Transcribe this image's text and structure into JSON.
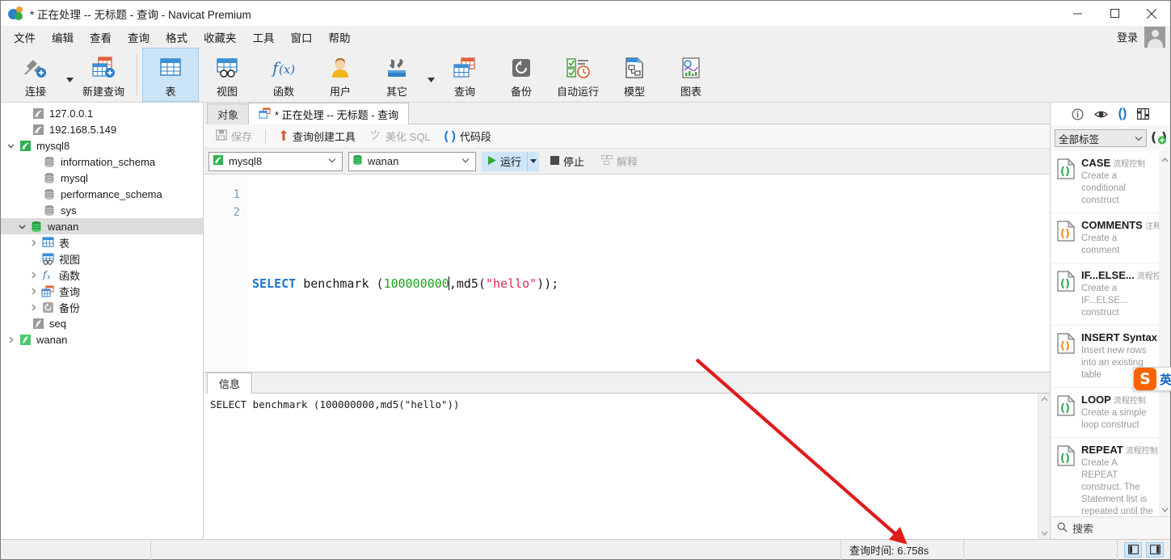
{
  "window": {
    "title": "* 正在处理 -- 无标题 - 查询 - Navicat Premium",
    "minimize_label": "最小化",
    "maximize_label": "最大化",
    "close_label": "关闭"
  },
  "menubar": {
    "items": [
      {
        "label": "文件"
      },
      {
        "label": "编辑"
      },
      {
        "label": "查看"
      },
      {
        "label": "查询"
      },
      {
        "label": "格式"
      },
      {
        "label": "收藏夹"
      },
      {
        "label": "工具"
      },
      {
        "label": "窗口"
      },
      {
        "label": "帮助"
      }
    ],
    "login_label": "登录"
  },
  "ribbon": {
    "items": [
      {
        "label": "连接",
        "icon": "connection-icon",
        "has_caret": true,
        "selected": false
      },
      {
        "label": "新建查询",
        "icon": "new-query-icon",
        "has_caret": false,
        "selected": false
      },
      {
        "label": "表",
        "icon": "table-icon",
        "has_caret": false,
        "selected": true
      },
      {
        "label": "视图",
        "icon": "view-icon",
        "has_caret": false,
        "selected": false
      },
      {
        "label": "函数",
        "icon": "function-icon",
        "has_caret": false,
        "selected": false
      },
      {
        "label": "用户",
        "icon": "user-icon",
        "has_caret": false,
        "selected": false
      },
      {
        "label": "其它",
        "icon": "other-tools-icon",
        "has_caret": true,
        "selected": false
      },
      {
        "label": "查询",
        "icon": "query-icon",
        "has_caret": false,
        "selected": false
      },
      {
        "label": "备份",
        "icon": "backup-icon",
        "has_caret": false,
        "selected": false
      },
      {
        "label": "自动运行",
        "icon": "automation-icon",
        "has_caret": false,
        "selected": false
      },
      {
        "label": "模型",
        "icon": "model-icon",
        "has_caret": false,
        "selected": false
      },
      {
        "label": "图表",
        "icon": "chart-icon",
        "has_caret": false,
        "selected": false
      }
    ]
  },
  "sidebar": {
    "tree": [
      {
        "label": "127.0.0.1",
        "icon": "mysql-conn-icon",
        "indent": 1,
        "twisty": "none",
        "selected": false
      },
      {
        "label": "192.168.5.149",
        "icon": "mysql-conn-icon",
        "indent": 1,
        "twisty": "none",
        "selected": false
      },
      {
        "label": "mysql8",
        "icon": "mysql-conn-open-icon",
        "indent": 0,
        "twisty": "expanded",
        "selected": false
      },
      {
        "label": "information_schema",
        "icon": "database-icon",
        "indent": 2,
        "twisty": "none",
        "selected": false
      },
      {
        "label": "mysql",
        "icon": "database-icon",
        "indent": 2,
        "twisty": "none",
        "selected": false
      },
      {
        "label": "performance_schema",
        "icon": "database-icon",
        "indent": 2,
        "twisty": "none",
        "selected": false
      },
      {
        "label": "sys",
        "icon": "database-icon",
        "indent": 2,
        "twisty": "none",
        "selected": false
      },
      {
        "label": "wanan",
        "icon": "database-open-icon",
        "indent": 1,
        "twisty": "expanded",
        "selected": true
      },
      {
        "label": "表",
        "icon": "table-icon",
        "indent": 2,
        "twisty": "collapsed",
        "selected": false
      },
      {
        "label": "视图",
        "icon": "view-icon",
        "indent": 2,
        "twisty": "none",
        "selected": false
      },
      {
        "label": "函数",
        "icon": "function-icon",
        "indent": 2,
        "twisty": "collapsed",
        "selected": false
      },
      {
        "label": "查询",
        "icon": "query-icon",
        "indent": 2,
        "twisty": "collapsed",
        "selected": false
      },
      {
        "label": "备份",
        "icon": "backup-icon",
        "indent": 2,
        "twisty": "collapsed",
        "selected": false
      },
      {
        "label": "seq",
        "icon": "mariadb-conn-icon",
        "indent": 1,
        "twisty": "none",
        "selected": false
      },
      {
        "label": "wanan",
        "icon": "mariadb-conn-icon",
        "indent": 1,
        "twisty": "collapsed",
        "selected": false
      }
    ]
  },
  "center": {
    "tabs": [
      {
        "label": "对象",
        "active": false,
        "icon": "none"
      },
      {
        "label": "* 正在处理 -- 无标题 - 查询",
        "active": true,
        "icon": "query-icon"
      }
    ],
    "query_toolbar": [
      {
        "label": "保存",
        "icon": "save-icon",
        "disabled": true
      },
      {
        "label": "查询创建工具",
        "icon": "query-builder-icon",
        "disabled": false
      },
      {
        "label": "美化 SQL",
        "icon": "beautify-icon",
        "disabled": true
      },
      {
        "label": "代码段",
        "icon": "snippet-icon",
        "disabled": false
      }
    ],
    "connection_combo": {
      "value": "mysql8",
      "icon": "mysql-conn-open-icon"
    },
    "database_combo": {
      "value": "wanan",
      "icon": "database-open-icon"
    },
    "run_label": "运行",
    "stop_label": "停止",
    "explain_label": "解释",
    "editor": {
      "line_numbers": [
        "1",
        "2"
      ],
      "sql_tokens": [
        {
          "t": "SELECT",
          "c": "kw"
        },
        {
          "t": " benchmark (",
          "c": "pl"
        },
        {
          "t": "100000000",
          "c": "num"
        },
        {
          "t": "|CARET|",
          "c": "caret"
        },
        {
          "t": ",md5(",
          "c": "pl"
        },
        {
          "t": "\"hello\"",
          "c": "str"
        },
        {
          "t": "));",
          "c": "pl"
        }
      ]
    },
    "info_tab_label": "信息",
    "info_output": "SELECT benchmark (100000000,md5(\"hello\"))"
  },
  "right_panel": {
    "icons": [
      {
        "name": "info-icon",
        "active": false
      },
      {
        "name": "eye-icon",
        "active": false
      },
      {
        "name": "snippet-icon",
        "active": true
      },
      {
        "name": "grid-icon",
        "active": false
      }
    ],
    "filter_value": "全部标签",
    "add_snippet_label": "新建代码段",
    "snippets": [
      {
        "title": "CASE",
        "tag": "流程控制",
        "desc": "Create a conditional construct",
        "icon_color": "#2aa84a"
      },
      {
        "title": "COMMENTS",
        "tag": "注释",
        "desc": "Create a comment",
        "icon_color": "#f08a24"
      },
      {
        "title": "IF...ELSE...",
        "tag": "流程控制",
        "desc": "Create a IF...ELSE... construct",
        "icon_color": "#2aa84a"
      },
      {
        "title": "INSERT Syntax",
        "tag": "",
        "desc": "Insert new rows into an existing table",
        "icon_color": "#f08a24"
      },
      {
        "title": "LOOP",
        "tag": "流程控制",
        "desc": "Create a simple loop construct",
        "icon_color": "#2aa84a"
      },
      {
        "title": "REPEAT",
        "tag": "流程控制",
        "desc": "Create A REPEAT construct. The Statement list is repeated until the search_condition expression is true.",
        "icon_color": "#2aa84a"
      }
    ],
    "search_placeholder": "搜索"
  },
  "statusbar": {
    "query_time": "查询时间: 6.758s",
    "toggle_left_label": "切换左侧面板",
    "toggle_right_label": "切换右侧面板"
  },
  "overlays": {
    "arrow_color": "#e01b1b",
    "ime": {
      "logo": "S",
      "mode": "英"
    }
  }
}
